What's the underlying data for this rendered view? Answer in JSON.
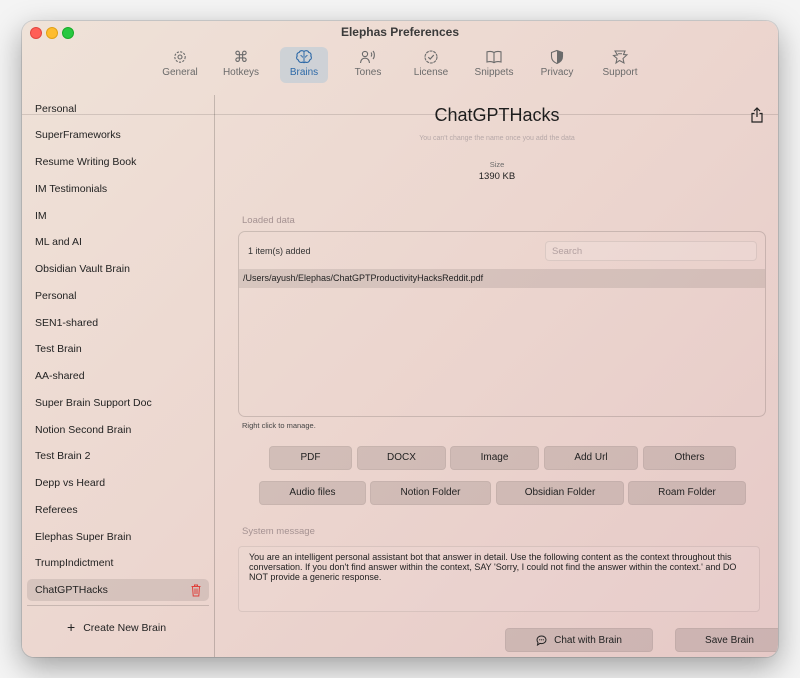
{
  "window": {
    "title": "Elephas Preferences"
  },
  "toolbar": {
    "tabs": [
      {
        "label": "General",
        "icon": "gear-icon"
      },
      {
        "label": "Hotkeys",
        "icon": "command-icon"
      },
      {
        "label": "Brains",
        "icon": "brain-icon",
        "active": true
      },
      {
        "label": "Tones",
        "icon": "voice-icon"
      },
      {
        "label": "License",
        "icon": "seal-check-icon"
      },
      {
        "label": "Snippets",
        "icon": "book-icon"
      },
      {
        "label": "Privacy",
        "icon": "shield-icon"
      },
      {
        "label": "Support",
        "icon": "support-icon"
      }
    ],
    "accent_color": "#2e6aa8"
  },
  "sidebar": {
    "items": [
      {
        "label": "Personal"
      },
      {
        "label": "SuperFrameworks"
      },
      {
        "label": "Resume Writing Book"
      },
      {
        "label": "IM Testimonials"
      },
      {
        "label": "IM"
      },
      {
        "label": "ML and AI"
      },
      {
        "label": "Obsidian Vault Brain"
      },
      {
        "label": "Personal"
      },
      {
        "label": "SEN1-shared"
      },
      {
        "label": "Test Brain"
      },
      {
        "label": "AA-shared"
      },
      {
        "label": "Super Brain Support Doc"
      },
      {
        "label": "Notion Second Brain"
      },
      {
        "label": "Test Brain 2"
      },
      {
        "label": "Depp vs Heard"
      },
      {
        "label": "Referees"
      },
      {
        "label": "Elephas Super Brain"
      },
      {
        "label": "TrumpIndictment"
      },
      {
        "label": "ChatGPTHacks",
        "selected": true
      }
    ],
    "create_label": "Create New Brain"
  },
  "brain": {
    "title": "ChatGPTHacks",
    "name_note": "You can't change the name once you add the data",
    "size_label": "Size",
    "size_value": "1390 KB",
    "loaded_label": "Loaded data",
    "items_count": "1 item(s) added",
    "search_placeholder": "Search",
    "files": [
      "/Users/ayush/Elephas/ChatGPTProductivityHacksReddit.pdf"
    ],
    "hint": "Right click to manage.",
    "add_buttons_row1": [
      "PDF",
      "DOCX",
      "Image",
      "Add Url",
      "Others"
    ],
    "add_buttons_row2": [
      "Audio files",
      "Notion Folder",
      "Obsidian Folder",
      "Roam Folder"
    ],
    "system_label": "System message",
    "system_message": "You are an intelligent personal assistant bot that answer in detail. Use the following content as the context throughout this conversation. If you don't find answer within the context, SAY 'Sorry, I could not find the answer within the context.' and DO NOT provide a generic response.",
    "chat_label": "Chat with Brain",
    "save_label": "Save Brain"
  }
}
